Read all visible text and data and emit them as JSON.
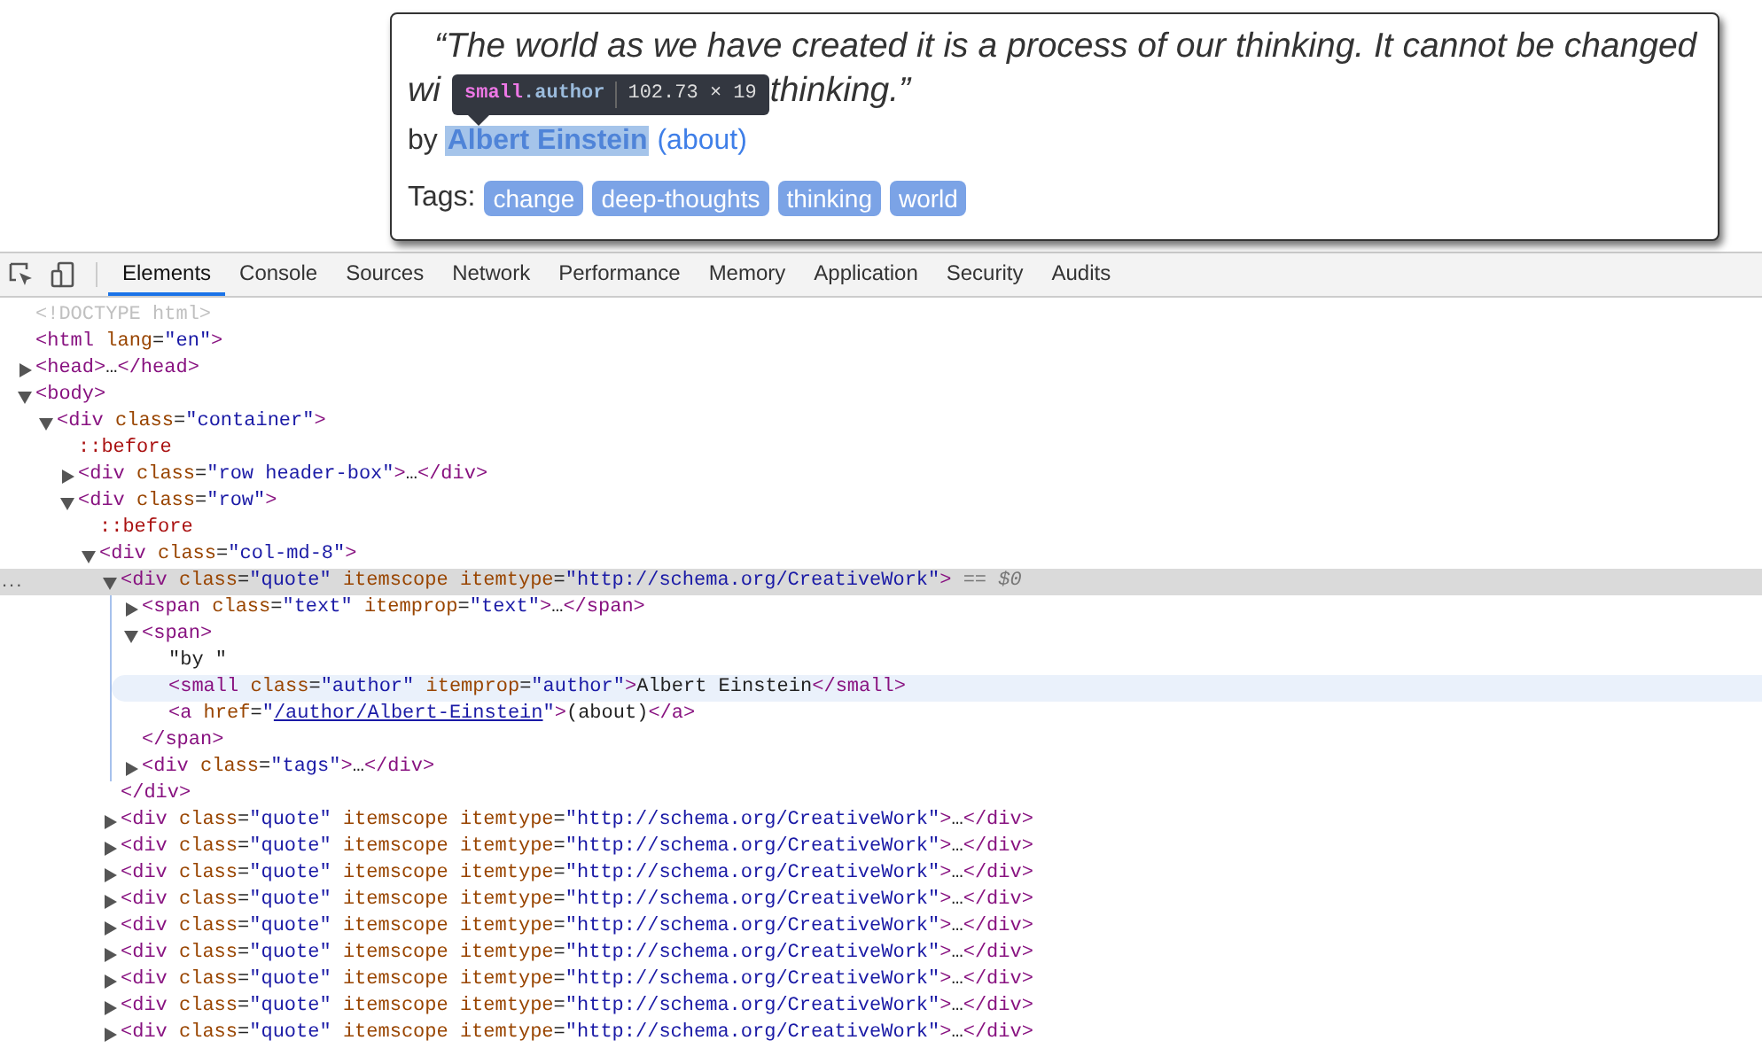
{
  "quote_card": {
    "line_1": "“The world as we have created it is a process of our thinking. It cannot be changed",
    "line_2_start": "wi",
    "line_2_end": "thinking.”",
    "by_label": "by",
    "author": "Albert Einstein",
    "author_highlighted": true,
    "about_link": "(about)",
    "tags_label": "Tags:",
    "tags": [
      "change",
      "deep-thoughts",
      "thinking",
      "world"
    ],
    "tooltip": {
      "tag": "small",
      "class_name": ".author",
      "size": "102.73 × 19"
    }
  },
  "devtools": {
    "tabs": [
      {
        "label": "Elements",
        "selected": true
      },
      {
        "label": "Console",
        "selected": false
      },
      {
        "label": "Sources",
        "selected": false
      },
      {
        "label": "Network",
        "selected": false
      },
      {
        "label": "Performance",
        "selected": false
      },
      {
        "label": "Memory",
        "selected": false
      },
      {
        "label": "Application",
        "selected": false
      },
      {
        "label": "Security",
        "selected": false
      },
      {
        "label": "Audits",
        "selected": false
      }
    ],
    "dom": [
      {
        "parts": [
          {
            "kind": "doctype",
            "text": "<!DOCTYPE html>"
          }
        ],
        "selected": false,
        "hovered": false
      },
      {
        "parts": [
          {
            "kind": "tag",
            "text": "<html"
          },
          {
            "kind": "attr",
            "text": " lang"
          },
          {
            "kind": "eq",
            "text": "="
          },
          {
            "kind": "val",
            "text": "\"en\""
          },
          {
            "kind": "tag",
            "text": ">"
          }
        ],
        "selected": false,
        "hovered": false
      },
      {
        "parts": [
          {
            "kind": "tag",
            "text": "<head>"
          },
          {
            "kind": "text",
            "text": "…"
          },
          {
            "kind": "tag",
            "text": "</head>"
          }
        ],
        "expanded": false,
        "selected": false,
        "hovered": false
      },
      {
        "parts": [
          {
            "kind": "tag",
            "text": "<body>"
          }
        ],
        "expanded": true,
        "selected": false,
        "hovered": false,
        "children": [
          {
            "parts": [
              {
                "kind": "tag",
                "text": "<div"
              },
              {
                "kind": "attr",
                "text": " class"
              },
              {
                "kind": "eq",
                "text": "="
              },
              {
                "kind": "val",
                "text": "\"container\""
              },
              {
                "kind": "tag",
                "text": ">"
              }
            ],
            "expanded": true,
            "selected": false,
            "hovered": false,
            "children": [
              {
                "parts": [
                  {
                    "kind": "pseudo",
                    "text": "::before"
                  }
                ],
                "selected": false,
                "hovered": false
              },
              {
                "parts": [
                  {
                    "kind": "tag",
                    "text": "<div"
                  },
                  {
                    "kind": "attr",
                    "text": " class"
                  },
                  {
                    "kind": "eq",
                    "text": "="
                  },
                  {
                    "kind": "val",
                    "text": "\"row header-box\""
                  },
                  {
                    "kind": "tag",
                    "text": ">"
                  },
                  {
                    "kind": "text",
                    "text": "…"
                  },
                  {
                    "kind": "tag",
                    "text": "</div>"
                  }
                ],
                "expanded": false,
                "selected": false,
                "hovered": false
              },
              {
                "parts": [
                  {
                    "kind": "tag",
                    "text": "<div"
                  },
                  {
                    "kind": "attr",
                    "text": " class"
                  },
                  {
                    "kind": "eq",
                    "text": "="
                  },
                  {
                    "kind": "val",
                    "text": "\"row\""
                  },
                  {
                    "kind": "tag",
                    "text": ">"
                  }
                ],
                "expanded": true,
                "selected": false,
                "hovered": false,
                "children": [
                  {
                    "parts": [
                      {
                        "kind": "pseudo",
                        "text": "::before"
                      }
                    ],
                    "selected": false,
                    "hovered": false
                  },
                  {
                    "parts": [
                      {
                        "kind": "tag",
                        "text": "<div"
                      },
                      {
                        "kind": "attr",
                        "text": " class"
                      },
                      {
                        "kind": "eq",
                        "text": "="
                      },
                      {
                        "kind": "val",
                        "text": "\"col-md-8\""
                      },
                      {
                        "kind": "tag",
                        "text": ">"
                      }
                    ],
                    "expanded": true,
                    "selected": false,
                    "hovered": false,
                    "children": [
                      {
                        "parts": [
                          {
                            "kind": "tag",
                            "text": "<div"
                          },
                          {
                            "kind": "attr",
                            "text": " class"
                          },
                          {
                            "kind": "eq",
                            "text": "="
                          },
                          {
                            "kind": "val",
                            "text": "\"quote\""
                          },
                          {
                            "kind": "attr",
                            "text": " itemscope"
                          },
                          {
                            "kind": "attr",
                            "text": " itemtype"
                          },
                          {
                            "kind": "eq",
                            "text": "="
                          },
                          {
                            "kind": "val",
                            "text": "\"http://schema.org/CreativeWork\""
                          },
                          {
                            "kind": "tag",
                            "text": ">"
                          },
                          {
                            "kind": "hint",
                            "text": " == $0"
                          }
                        ],
                        "more_button": "...",
                        "expanded": true,
                        "selected": true,
                        "hovered": false,
                        "closing": [
                          {
                            "kind": "tag",
                            "text": "</div>"
                          }
                        ],
                        "children": [
                          {
                            "parts": [
                              {
                                "kind": "tag",
                                "text": "<span"
                              },
                              {
                                "kind": "attr",
                                "text": " class"
                              },
                              {
                                "kind": "eq",
                                "text": "="
                              },
                              {
                                "kind": "val",
                                "text": "\"text\""
                              },
                              {
                                "kind": "attr",
                                "text": " itemprop"
                              },
                              {
                                "kind": "eq",
                                "text": "="
                              },
                              {
                                "kind": "val",
                                "text": "\"text\""
                              },
                              {
                                "kind": "tag",
                                "text": ">"
                              },
                              {
                                "kind": "text",
                                "text": "…"
                              },
                              {
                                "kind": "tag",
                                "text": "</span>"
                              }
                            ],
                            "expanded": false,
                            "selected": false,
                            "hovered": false
                          },
                          {
                            "parts": [
                              {
                                "kind": "tag",
                                "text": "<span>"
                              }
                            ],
                            "expanded": true,
                            "selected": false,
                            "hovered": false,
                            "closing": [
                              {
                                "kind": "tag",
                                "text": "</span>"
                              }
                            ],
                            "children": [
                              {
                                "parts": [
                                  {
                                    "kind": "text",
                                    "text": "\"by \""
                                  }
                                ],
                                "selected": false,
                                "hovered": false
                              },
                              {
                                "parts": [
                                  {
                                    "kind": "tag",
                                    "text": "<small"
                                  },
                                  {
                                    "kind": "attr",
                                    "text": " class"
                                  },
                                  {
                                    "kind": "eq",
                                    "text": "="
                                  },
                                  {
                                    "kind": "val",
                                    "text": "\"author\""
                                  },
                                  {
                                    "kind": "attr",
                                    "text": " itemprop"
                                  },
                                  {
                                    "kind": "eq",
                                    "text": "="
                                  },
                                  {
                                    "kind": "val",
                                    "text": "\"author\""
                                  },
                                  {
                                    "kind": "tag",
                                    "text": ">"
                                  },
                                  {
                                    "kind": "text",
                                    "text": "Albert Einstein"
                                  },
                                  {
                                    "kind": "tag",
                                    "text": "</small>"
                                  }
                                ],
                                "selected": false,
                                "hovered": true
                              },
                              {
                                "parts": [
                                  {
                                    "kind": "tag",
                                    "text": "<a"
                                  },
                                  {
                                    "kind": "attr",
                                    "text": " href"
                                  },
                                  {
                                    "kind": "eq",
                                    "text": "="
                                  },
                                  {
                                    "kind": "val",
                                    "text": "\""
                                  },
                                  {
                                    "kind": "link",
                                    "text": "/author/Albert-Einstein"
                                  },
                                  {
                                    "kind": "val",
                                    "text": "\""
                                  },
                                  {
                                    "kind": "tag",
                                    "text": ">"
                                  },
                                  {
                                    "kind": "text",
                                    "text": "(about)"
                                  },
                                  {
                                    "kind": "tag",
                                    "text": "</a>"
                                  }
                                ],
                                "selected": false,
                                "hovered": false
                              }
                            ]
                          },
                          {
                            "parts": [
                              {
                                "kind": "tag",
                                "text": "<div"
                              },
                              {
                                "kind": "attr",
                                "text": " class"
                              },
                              {
                                "kind": "eq",
                                "text": "="
                              },
                              {
                                "kind": "val",
                                "text": "\"tags\""
                              },
                              {
                                "kind": "tag",
                                "text": ">"
                              },
                              {
                                "kind": "text",
                                "text": "…"
                              },
                              {
                                "kind": "tag",
                                "text": "</div>"
                              }
                            ],
                            "expanded": false,
                            "selected": false,
                            "hovered": false
                          }
                        ]
                      },
                      {
                        "parts": [
                          {
                            "kind": "tag",
                            "text": "<div"
                          },
                          {
                            "kind": "attr",
                            "text": " class"
                          },
                          {
                            "kind": "eq",
                            "text": "="
                          },
                          {
                            "kind": "val",
                            "text": "\"quote\""
                          },
                          {
                            "kind": "attr",
                            "text": " itemscope"
                          },
                          {
                            "kind": "attr",
                            "text": " itemtype"
                          },
                          {
                            "kind": "eq",
                            "text": "="
                          },
                          {
                            "kind": "val",
                            "text": "\"http://schema.org/CreativeWork\""
                          },
                          {
                            "kind": "tag",
                            "text": ">"
                          },
                          {
                            "kind": "text",
                            "text": "…"
                          },
                          {
                            "kind": "tag",
                            "text": "</div>"
                          }
                        ],
                        "expanded": false,
                        "selected": false,
                        "hovered": false
                      },
                      {
                        "parts": [
                          {
                            "kind": "tag",
                            "text": "<div"
                          },
                          {
                            "kind": "attr",
                            "text": " class"
                          },
                          {
                            "kind": "eq",
                            "text": "="
                          },
                          {
                            "kind": "val",
                            "text": "\"quote\""
                          },
                          {
                            "kind": "attr",
                            "text": " itemscope"
                          },
                          {
                            "kind": "attr",
                            "text": " itemtype"
                          },
                          {
                            "kind": "eq",
                            "text": "="
                          },
                          {
                            "kind": "val",
                            "text": "\"http://schema.org/CreativeWork\""
                          },
                          {
                            "kind": "tag",
                            "text": ">"
                          },
                          {
                            "kind": "text",
                            "text": "…"
                          },
                          {
                            "kind": "tag",
                            "text": "</div>"
                          }
                        ],
                        "expanded": false,
                        "selected": false,
                        "hovered": false
                      },
                      {
                        "parts": [
                          {
                            "kind": "tag",
                            "text": "<div"
                          },
                          {
                            "kind": "attr",
                            "text": " class"
                          },
                          {
                            "kind": "eq",
                            "text": "="
                          },
                          {
                            "kind": "val",
                            "text": "\"quote\""
                          },
                          {
                            "kind": "attr",
                            "text": " itemscope"
                          },
                          {
                            "kind": "attr",
                            "text": " itemtype"
                          },
                          {
                            "kind": "eq",
                            "text": "="
                          },
                          {
                            "kind": "val",
                            "text": "\"http://schema.org/CreativeWork\""
                          },
                          {
                            "kind": "tag",
                            "text": ">"
                          },
                          {
                            "kind": "text",
                            "text": "…"
                          },
                          {
                            "kind": "tag",
                            "text": "</div>"
                          }
                        ],
                        "expanded": false,
                        "selected": false,
                        "hovered": false
                      },
                      {
                        "parts": [
                          {
                            "kind": "tag",
                            "text": "<div"
                          },
                          {
                            "kind": "attr",
                            "text": " class"
                          },
                          {
                            "kind": "eq",
                            "text": "="
                          },
                          {
                            "kind": "val",
                            "text": "\"quote\""
                          },
                          {
                            "kind": "attr",
                            "text": " itemscope"
                          },
                          {
                            "kind": "attr",
                            "text": " itemtype"
                          },
                          {
                            "kind": "eq",
                            "text": "="
                          },
                          {
                            "kind": "val",
                            "text": "\"http://schema.org/CreativeWork\""
                          },
                          {
                            "kind": "tag",
                            "text": ">"
                          },
                          {
                            "kind": "text",
                            "text": "…"
                          },
                          {
                            "kind": "tag",
                            "text": "</div>"
                          }
                        ],
                        "expanded": false,
                        "selected": false,
                        "hovered": false
                      },
                      {
                        "parts": [
                          {
                            "kind": "tag",
                            "text": "<div"
                          },
                          {
                            "kind": "attr",
                            "text": " class"
                          },
                          {
                            "kind": "eq",
                            "text": "="
                          },
                          {
                            "kind": "val",
                            "text": "\"quote\""
                          },
                          {
                            "kind": "attr",
                            "text": " itemscope"
                          },
                          {
                            "kind": "attr",
                            "text": " itemtype"
                          },
                          {
                            "kind": "eq",
                            "text": "="
                          },
                          {
                            "kind": "val",
                            "text": "\"http://schema.org/CreativeWork\""
                          },
                          {
                            "kind": "tag",
                            "text": ">"
                          },
                          {
                            "kind": "text",
                            "text": "…"
                          },
                          {
                            "kind": "tag",
                            "text": "</div>"
                          }
                        ],
                        "expanded": false,
                        "selected": false,
                        "hovered": false
                      },
                      {
                        "parts": [
                          {
                            "kind": "tag",
                            "text": "<div"
                          },
                          {
                            "kind": "attr",
                            "text": " class"
                          },
                          {
                            "kind": "eq",
                            "text": "="
                          },
                          {
                            "kind": "val",
                            "text": "\"quote\""
                          },
                          {
                            "kind": "attr",
                            "text": " itemscope"
                          },
                          {
                            "kind": "attr",
                            "text": " itemtype"
                          },
                          {
                            "kind": "eq",
                            "text": "="
                          },
                          {
                            "kind": "val",
                            "text": "\"http://schema.org/CreativeWork\""
                          },
                          {
                            "kind": "tag",
                            "text": ">"
                          },
                          {
                            "kind": "text",
                            "text": "…"
                          },
                          {
                            "kind": "tag",
                            "text": "</div>"
                          }
                        ],
                        "expanded": false,
                        "selected": false,
                        "hovered": false
                      },
                      {
                        "parts": [
                          {
                            "kind": "tag",
                            "text": "<div"
                          },
                          {
                            "kind": "attr",
                            "text": " class"
                          },
                          {
                            "kind": "eq",
                            "text": "="
                          },
                          {
                            "kind": "val",
                            "text": "\"quote\""
                          },
                          {
                            "kind": "attr",
                            "text": " itemscope"
                          },
                          {
                            "kind": "attr",
                            "text": " itemtype"
                          },
                          {
                            "kind": "eq",
                            "text": "="
                          },
                          {
                            "kind": "val",
                            "text": "\"http://schema.org/CreativeWork\""
                          },
                          {
                            "kind": "tag",
                            "text": ">"
                          },
                          {
                            "kind": "text",
                            "text": "…"
                          },
                          {
                            "kind": "tag",
                            "text": "</div>"
                          }
                        ],
                        "expanded": false,
                        "selected": false,
                        "hovered": false
                      },
                      {
                        "parts": [
                          {
                            "kind": "tag",
                            "text": "<div"
                          },
                          {
                            "kind": "attr",
                            "text": " class"
                          },
                          {
                            "kind": "eq",
                            "text": "="
                          },
                          {
                            "kind": "val",
                            "text": "\"quote\""
                          },
                          {
                            "kind": "attr",
                            "text": " itemscope"
                          },
                          {
                            "kind": "attr",
                            "text": " itemtype"
                          },
                          {
                            "kind": "eq",
                            "text": "="
                          },
                          {
                            "kind": "val",
                            "text": "\"http://schema.org/CreativeWork\""
                          },
                          {
                            "kind": "tag",
                            "text": ">"
                          },
                          {
                            "kind": "text",
                            "text": "…"
                          },
                          {
                            "kind": "tag",
                            "text": "</div>"
                          }
                        ],
                        "expanded": false,
                        "selected": false,
                        "hovered": false
                      },
                      {
                        "parts": [
                          {
                            "kind": "tag",
                            "text": "<div"
                          },
                          {
                            "kind": "attr",
                            "text": " class"
                          },
                          {
                            "kind": "eq",
                            "text": "="
                          },
                          {
                            "kind": "val",
                            "text": "\"quote\""
                          },
                          {
                            "kind": "attr",
                            "text": " itemscope"
                          },
                          {
                            "kind": "attr",
                            "text": " itemtype"
                          },
                          {
                            "kind": "eq",
                            "text": "="
                          },
                          {
                            "kind": "val",
                            "text": "\"http://schema.org/CreativeWork\""
                          },
                          {
                            "kind": "tag",
                            "text": ">"
                          },
                          {
                            "kind": "text",
                            "text": "…"
                          },
                          {
                            "kind": "tag",
                            "text": "</div>"
                          }
                        ],
                        "expanded": false,
                        "selected": false,
                        "hovered": false
                      }
                    ]
                  }
                ]
              }
            ]
          }
        ]
      }
    ]
  }
}
